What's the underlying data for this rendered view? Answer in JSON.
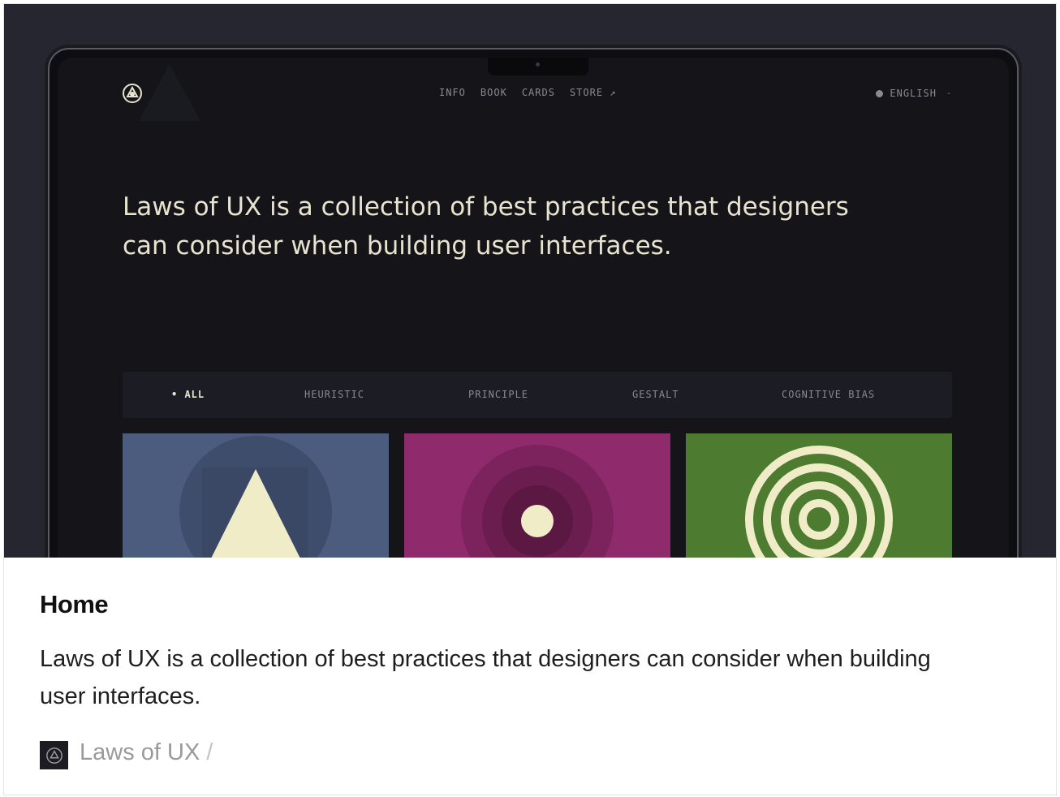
{
  "preview": {
    "nav": [
      {
        "label": "INFO"
      },
      {
        "label": "BOOK"
      },
      {
        "label": "CARDS"
      },
      {
        "label": "STORE ↗"
      }
    ],
    "language": {
      "label": "ENGLISH",
      "chevron": "-"
    },
    "headline": "Laws of UX is a collection of best practices that designers can consider when building user interfaces.",
    "filters": [
      {
        "label": "• ALL",
        "active": true
      },
      {
        "label": "HEURISTIC"
      },
      {
        "label": "PRINCIPLE"
      },
      {
        "label": "GESTALT"
      },
      {
        "label": "COGNITIVE BIAS"
      }
    ],
    "colors": {
      "background": "#262631",
      "screen": "#141419",
      "text": "#e8e4cf",
      "tile_blue": "#4b5c7f",
      "tile_magenta": "#8f2a6c",
      "tile_green": "#4d7b2f",
      "cream": "#f1ecc8"
    },
    "icons": [
      "laws-of-ux-logo-icon",
      "globe-icon",
      "triangle-icon",
      "concentric-dot-icon",
      "target-rings-icon"
    ]
  },
  "card": {
    "title": "Home",
    "description": "Laws of UX is a collection of best practices that designers can consider when building user interfaces.",
    "source": {
      "name": "Laws of UX",
      "separator": "/"
    }
  }
}
